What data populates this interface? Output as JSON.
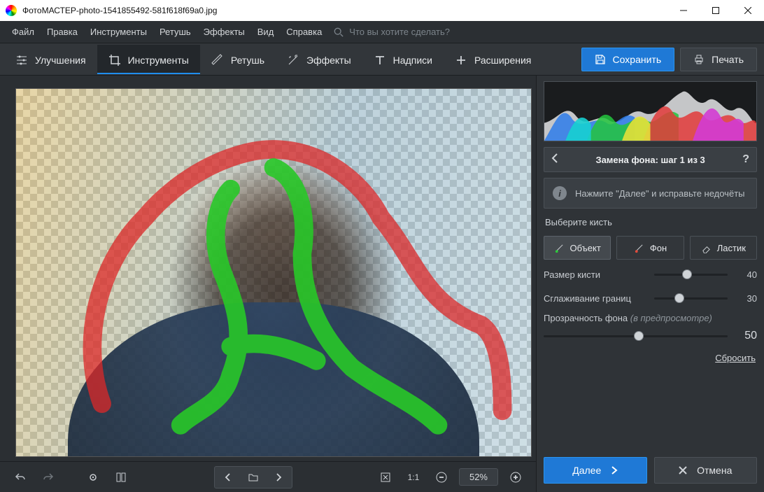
{
  "titlebar": {
    "app": "ФотоМАСТЕР",
    "sep": " - ",
    "file": "photo-1541855492-581f618f69a0.jpg"
  },
  "menu": {
    "file": "Файл",
    "edit": "Правка",
    "tools": "Инструменты",
    "retouch": "Ретушь",
    "effects": "Эффекты",
    "view": "Вид",
    "help": "Справка",
    "search_ph": "Что вы хотите сделать?"
  },
  "tabs": {
    "improve": "Улучшения",
    "tools": "Инструменты",
    "retouch": "Ретушь",
    "effects": "Эффекты",
    "text": "Надписи",
    "ext": "Расширения"
  },
  "actions": {
    "save": "Сохранить",
    "print": "Печать"
  },
  "panel": {
    "title_prefix": "Замена фона: шаг ",
    "step_cur": "1",
    "step_of": " из ",
    "step_total": "3",
    "info": "Нажмите \"Далее\" и исправьте недочёты",
    "choose_brush": "Выберите кисть",
    "brush_obj": "Объект",
    "brush_bg": "Фон",
    "brush_eraser": "Ластик",
    "size_lbl": "Размер кисти",
    "size_val": "40",
    "smooth_lbl": "Сглаживание границ",
    "smooth_val": "30",
    "opacity_lbl": "Прозрачность фона ",
    "opacity_note": "(в предпросмотре)",
    "opacity_val": "50",
    "reset": "Сбросить",
    "next": "Далее",
    "cancel": "Отмена"
  },
  "zoom": {
    "ratio": "1:1",
    "percent": "52%"
  }
}
